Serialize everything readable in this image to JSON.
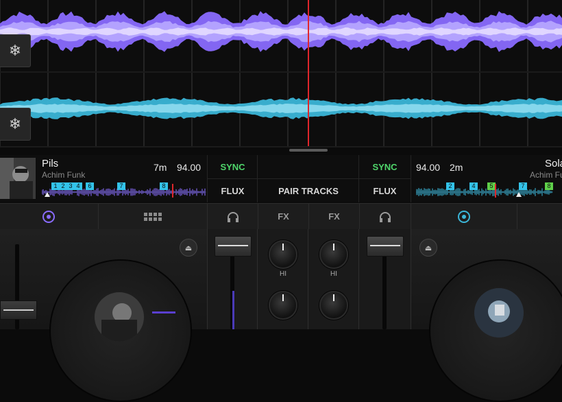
{
  "deck_a": {
    "title": "Pils",
    "artist": "Achim Funk",
    "time_remaining": "7m",
    "bpm": "94.00",
    "sync_label": "SYNC",
    "flux_label": "FLUX",
    "accent_color": "#8a6cff",
    "cues": [
      "1",
      "2",
      "3",
      "4",
      "6",
      "7",
      "8"
    ]
  },
  "deck_b": {
    "title": "Sola",
    "artist": "Achim Fu",
    "time_remaining": "2m",
    "bpm": "94.00",
    "sync_label": "SYNC",
    "flux_label": "FLUX",
    "accent_color": "#3bb6d8",
    "cues": [
      "2",
      "4",
      "5",
      "7",
      "8"
    ]
  },
  "center": {
    "pair_tracks_label": "PAIR TRACKS"
  },
  "mixer": {
    "fx_left": "FX",
    "fx_right": "FX",
    "hi_left": "HI",
    "hi_right": "HI"
  },
  "icons": {
    "freeze": "snowflake-icon",
    "headphones": "headphones-icon",
    "pads": "grid-icon",
    "eject": "eject-icon",
    "deck_mode": "record-icon"
  },
  "colors": {
    "playhead": "#e0262b",
    "sync_active": "#4fd66b",
    "cue_blue": "#33c3ea",
    "cue_green": "#5fd04a"
  }
}
